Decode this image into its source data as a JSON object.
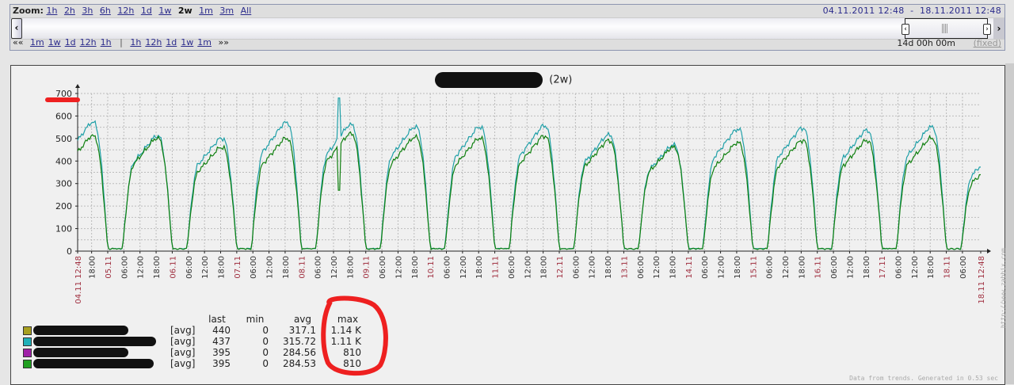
{
  "zoom_bar": {
    "zoom_label": "Zoom:",
    "zoom_options": [
      "1h",
      "2h",
      "3h",
      "6h",
      "12h",
      "1d",
      "1w",
      "2w",
      "1m",
      "3m",
      "All"
    ],
    "active_zoom": "2w",
    "period_from": "04.11.2011 12:48",
    "period_sep": "-",
    "period_to": "18.11.2011 12:48",
    "nav_back_icon": "«",
    "nav_back": [
      "1m",
      "1w",
      "1d",
      "12h",
      "1h"
    ],
    "nav_sep": "|",
    "nav_forward": [
      "1h",
      "12h",
      "1d",
      "1w",
      "1m"
    ],
    "nav_forward_icon": "»",
    "duration": "14d 00h 00m",
    "fixed_label": "(fixed)"
  },
  "graph": {
    "title_suffix": "(2w)",
    "footer": "Data from trends. Generated in 0.53 sec",
    "watermark": "http://www.zabbix.com"
  },
  "legend": {
    "headers": [
      "last",
      "min",
      "avg",
      "max"
    ],
    "items": [
      {
        "color": "#a8a020",
        "func": "[avg]",
        "last": "440",
        "min": "0",
        "avg": "317.1",
        "max": "1.14 K"
      },
      {
        "color": "#20b0b8",
        "func": "[avg]",
        "last": "437",
        "min": "0",
        "avg": "315.72",
        "max": "1.11 K"
      },
      {
        "color": "#a020a8",
        "func": "[avg]",
        "last": "395",
        "min": "0",
        "avg": "284.56",
        "max": "810"
      },
      {
        "color": "#20a020",
        "func": "[avg]",
        "last": "395",
        "min": "0",
        "avg": "284.53",
        "max": "810"
      }
    ]
  },
  "chart_data": {
    "type": "line",
    "title": "(2w)",
    "ylim": [
      0,
      700
    ],
    "y_ticks": [
      "0",
      "100",
      "200",
      "300",
      "400",
      "500",
      "600",
      "700"
    ],
    "x_range_hours": [
      0,
      336
    ],
    "x_tick_labels": [
      "04.11 12:48",
      "18:00",
      "05.11",
      "06:00",
      "12:00",
      "18:00",
      "06.11",
      "06:00",
      "12:00",
      "18:00",
      "07.11",
      "06:00",
      "12:00",
      "18:00",
      "08.11",
      "06:00",
      "12:00",
      "18:00",
      "09.11",
      "06:00",
      "12:00",
      "18:00",
      "10.11",
      "06:00",
      "12:00",
      "18:00",
      "11.11",
      "06:00",
      "12:00",
      "18:00",
      "12.11",
      "06:00",
      "12:00",
      "18:00",
      "13.11",
      "06:00",
      "12:00",
      "18:00",
      "14.11",
      "06:00",
      "12:00",
      "18:00",
      "15.11",
      "06:00",
      "12:00",
      "18:00",
      "16.11",
      "06:00",
      "12:00",
      "18:00",
      "17.11",
      "06:00",
      "12:00",
      "18:00",
      "18.11",
      "06:00",
      "18.11 12:48"
    ],
    "grid": true,
    "days": [
      "04.11",
      "05.11",
      "06.11",
      "07.11",
      "08.11",
      "09.11",
      "10.11",
      "11.11",
      "12.11",
      "13.11",
      "14.11",
      "15.11",
      "16.11",
      "17.11",
      "18.11"
    ],
    "series": [
      {
        "name": "series-teal",
        "color": "#20a0a8",
        "daily_peak": [
          570,
          510,
          500,
          570,
          560,
          550,
          550,
          555,
          515,
          470,
          540,
          545,
          535,
          550,
          440
        ],
        "night_min": 10,
        "spike": {
          "day": "08.11",
          "hour": 14,
          "value": 680
        }
      },
      {
        "name": "series-green",
        "color": "#108010",
        "daily_peak": [
          510,
          500,
          460,
          500,
          520,
          505,
          500,
          510,
          490,
          460,
          480,
          490,
          490,
          500,
          395
        ],
        "night_min": 10,
        "spike": {
          "day": "08.11",
          "hour": 14,
          "value": 270
        }
      }
    ],
    "colors": {
      "day_label": "#a03040",
      "hour_label": "#333333",
      "annotation": "#ee2020"
    }
  }
}
